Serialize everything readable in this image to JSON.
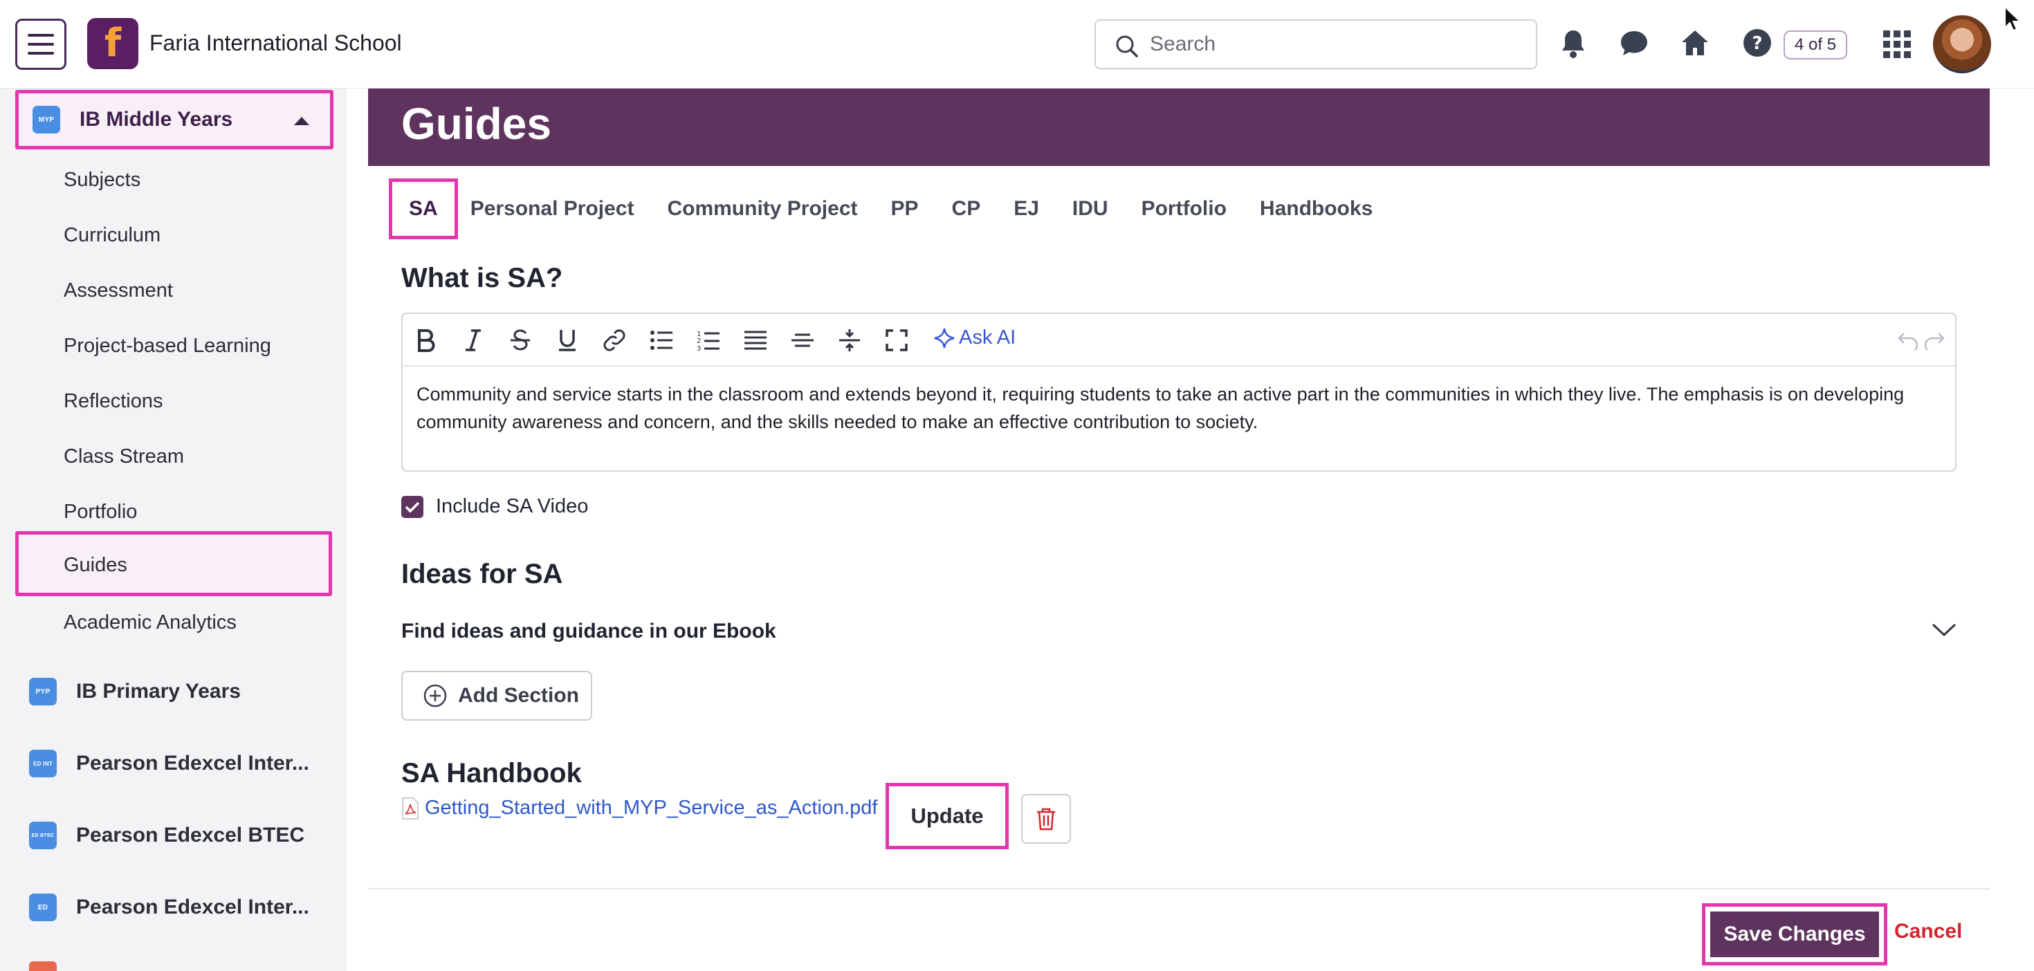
{
  "header": {
    "school_name": "Faria International School",
    "logo_letter": "f",
    "search_placeholder": "Search",
    "counter": "4 of 5"
  },
  "sidebar": {
    "program_active": {
      "label": "IB Middle Years",
      "badge": "MYP"
    },
    "sub_items": [
      "Subjects",
      "Curriculum",
      "Assessment",
      "Project-based Learning",
      "Reflections",
      "Class Stream",
      "Portfolio"
    ],
    "selected_item": "Guides",
    "after_item": "Academic Analytics",
    "programs": [
      {
        "label": "IB Primary Years",
        "badge": "PYP"
      },
      {
        "label": "Pearson Edexcel Inter...",
        "badge": "ED INT"
      },
      {
        "label": "Pearson Edexcel BTEC",
        "badge": "ED BTEC"
      },
      {
        "label": "Pearson Edexcel Inter...",
        "badge": "ED"
      }
    ]
  },
  "main": {
    "title": "Guides",
    "tabs": [
      "SA",
      "Personal Project",
      "Community Project",
      "PP",
      "CP",
      "EJ",
      "IDU",
      "Portfolio",
      "Handbooks"
    ],
    "section_what": "What is SA?",
    "ask_ai": "Ask AI",
    "editor_text": "Community and service starts in the classroom and extends beyond it, requiring students to take an active part in the communities in which they live. The emphasis is on developing community awareness and concern, and the skills needed to make an effective contribution to society.",
    "include_video_label": "Include SA Video",
    "ideas_heading": "Ideas for SA",
    "ebook_label": "Find ideas and guidance in our Ebook",
    "add_section_label": "Add Section",
    "handbook_heading": "SA Handbook",
    "file_name": "Getting_Started_with_MYP_Service_as_Action.pdf",
    "update_label": "Update",
    "save_label": "Save Changes",
    "cancel_label": "Cancel"
  },
  "colors": {
    "brand_purple": "#5e345f",
    "highlight_pink": "#e336ad",
    "link_blue": "#2f58c7",
    "danger_red": "#d3252d"
  }
}
